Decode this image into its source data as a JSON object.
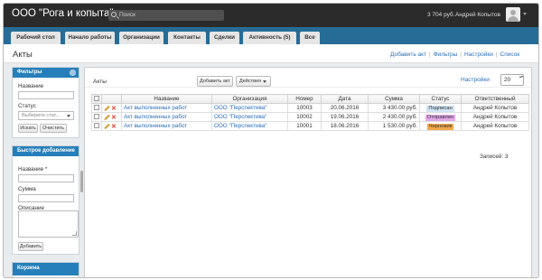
{
  "app": {
    "company": "ООО \"Рога и копыта\"",
    "search_placeholder": "Поиск",
    "balance": "3 704 руб.",
    "username": "Андрей Копытов"
  },
  "nav": [
    "Рабочий стол",
    "Начало работы",
    "Организации",
    "Контакты",
    "Сделки",
    "Активность (5)",
    "Все"
  ],
  "header": {
    "title": "Акты",
    "links": [
      "Добавить акт",
      "Фильтры",
      "Настройки",
      "Список"
    ]
  },
  "filters": {
    "title": "Фильтры",
    "name_label": "Название",
    "status_label": "Статус",
    "status_placeholder": "Выберите стат...",
    "search_button": "Искать",
    "clear_button": "Очистить"
  },
  "quick_add": {
    "title": "Быстрое добавление",
    "name_label": "Название *",
    "sum_label": "Сумма",
    "desc_label": "Описание",
    "add_button": "Добавить"
  },
  "cart": {
    "title": "Корзина"
  },
  "content": {
    "label": "Акты",
    "add_button": "Добавить акт",
    "actions_button": "Действия",
    "settings_link": "Настройки",
    "per_page": "20",
    "total": "Записей: 3"
  },
  "table": {
    "headers": [
      "Название",
      "Организация",
      "Номер",
      "Дата",
      "Сумма",
      "Статус",
      "Ответственный"
    ],
    "rows": [
      {
        "name": "Акт выполненных работ",
        "org": "ООО \"Перспектива\"",
        "number": "10003",
        "date": "20.06.2016",
        "sum": "3 430.00 руб.",
        "status": "Подписан",
        "status_color": "#cfe3f3",
        "owner": "Андрей Копытов"
      },
      {
        "name": "Акт выполненных работ",
        "org": "ООО \"Перспектива\"",
        "number": "10002",
        "date": "19.06.2016",
        "sum": "2 430.00 руб.",
        "status": "Отправлен",
        "status_color": "#e3a7e8",
        "owner": "Андрей Копытов"
      },
      {
        "name": "Акт выполненных работ",
        "org": "ООО \"Перспектива\"",
        "number": "10001",
        "date": "18.06.2016",
        "sum": "1 530.00 руб.",
        "status": "Черновик",
        "status_color": "#f2a84a",
        "owner": "Андрей Копытов"
      }
    ]
  }
}
